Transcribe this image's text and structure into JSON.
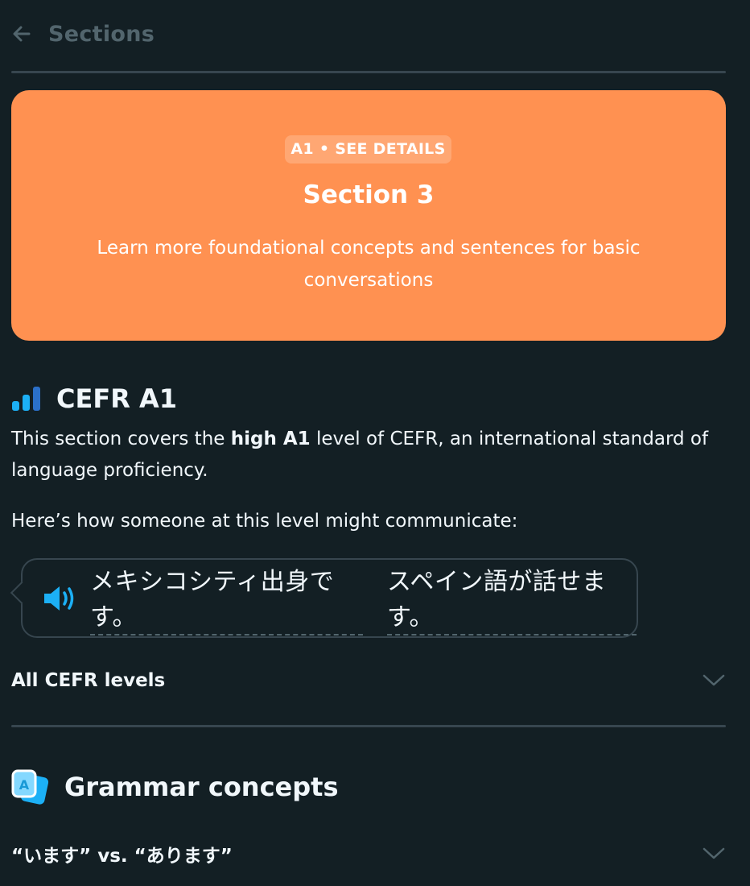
{
  "header": {
    "back_icon": "arrow-left-icon",
    "title": "Sections"
  },
  "section_card": {
    "badge": "A1 • SEE DETAILS",
    "title": "Section 3",
    "description": "Learn more foundational concepts and sentences for basic conversations",
    "color": "#ff9151"
  },
  "cefr": {
    "icon": "signal-bars-icon",
    "title": "CEFR A1",
    "intro_before": "This section covers the ",
    "intro_bold": "high A1",
    "intro_after": " level of CEFR, an international standard of language proficiency.",
    "example_lead": "Here’s how someone at this level might communicate:",
    "example_phrases": [
      "メキシコシティ出身です。",
      "スペイン語が話せます。"
    ],
    "speaker_icon": "speaker-icon"
  },
  "all_levels": {
    "label": "All CEFR levels",
    "icon": "chevron-down-icon"
  },
  "grammar": {
    "icon": "grammar-cards-icon",
    "title": "Grammar concepts",
    "items": [
      {
        "label": "“います” vs. “あります”"
      }
    ]
  },
  "colors": {
    "background": "#131f24",
    "divider": "#37464f",
    "muted_text": "#52656d",
    "accent_blue": "#1cb0f6"
  }
}
